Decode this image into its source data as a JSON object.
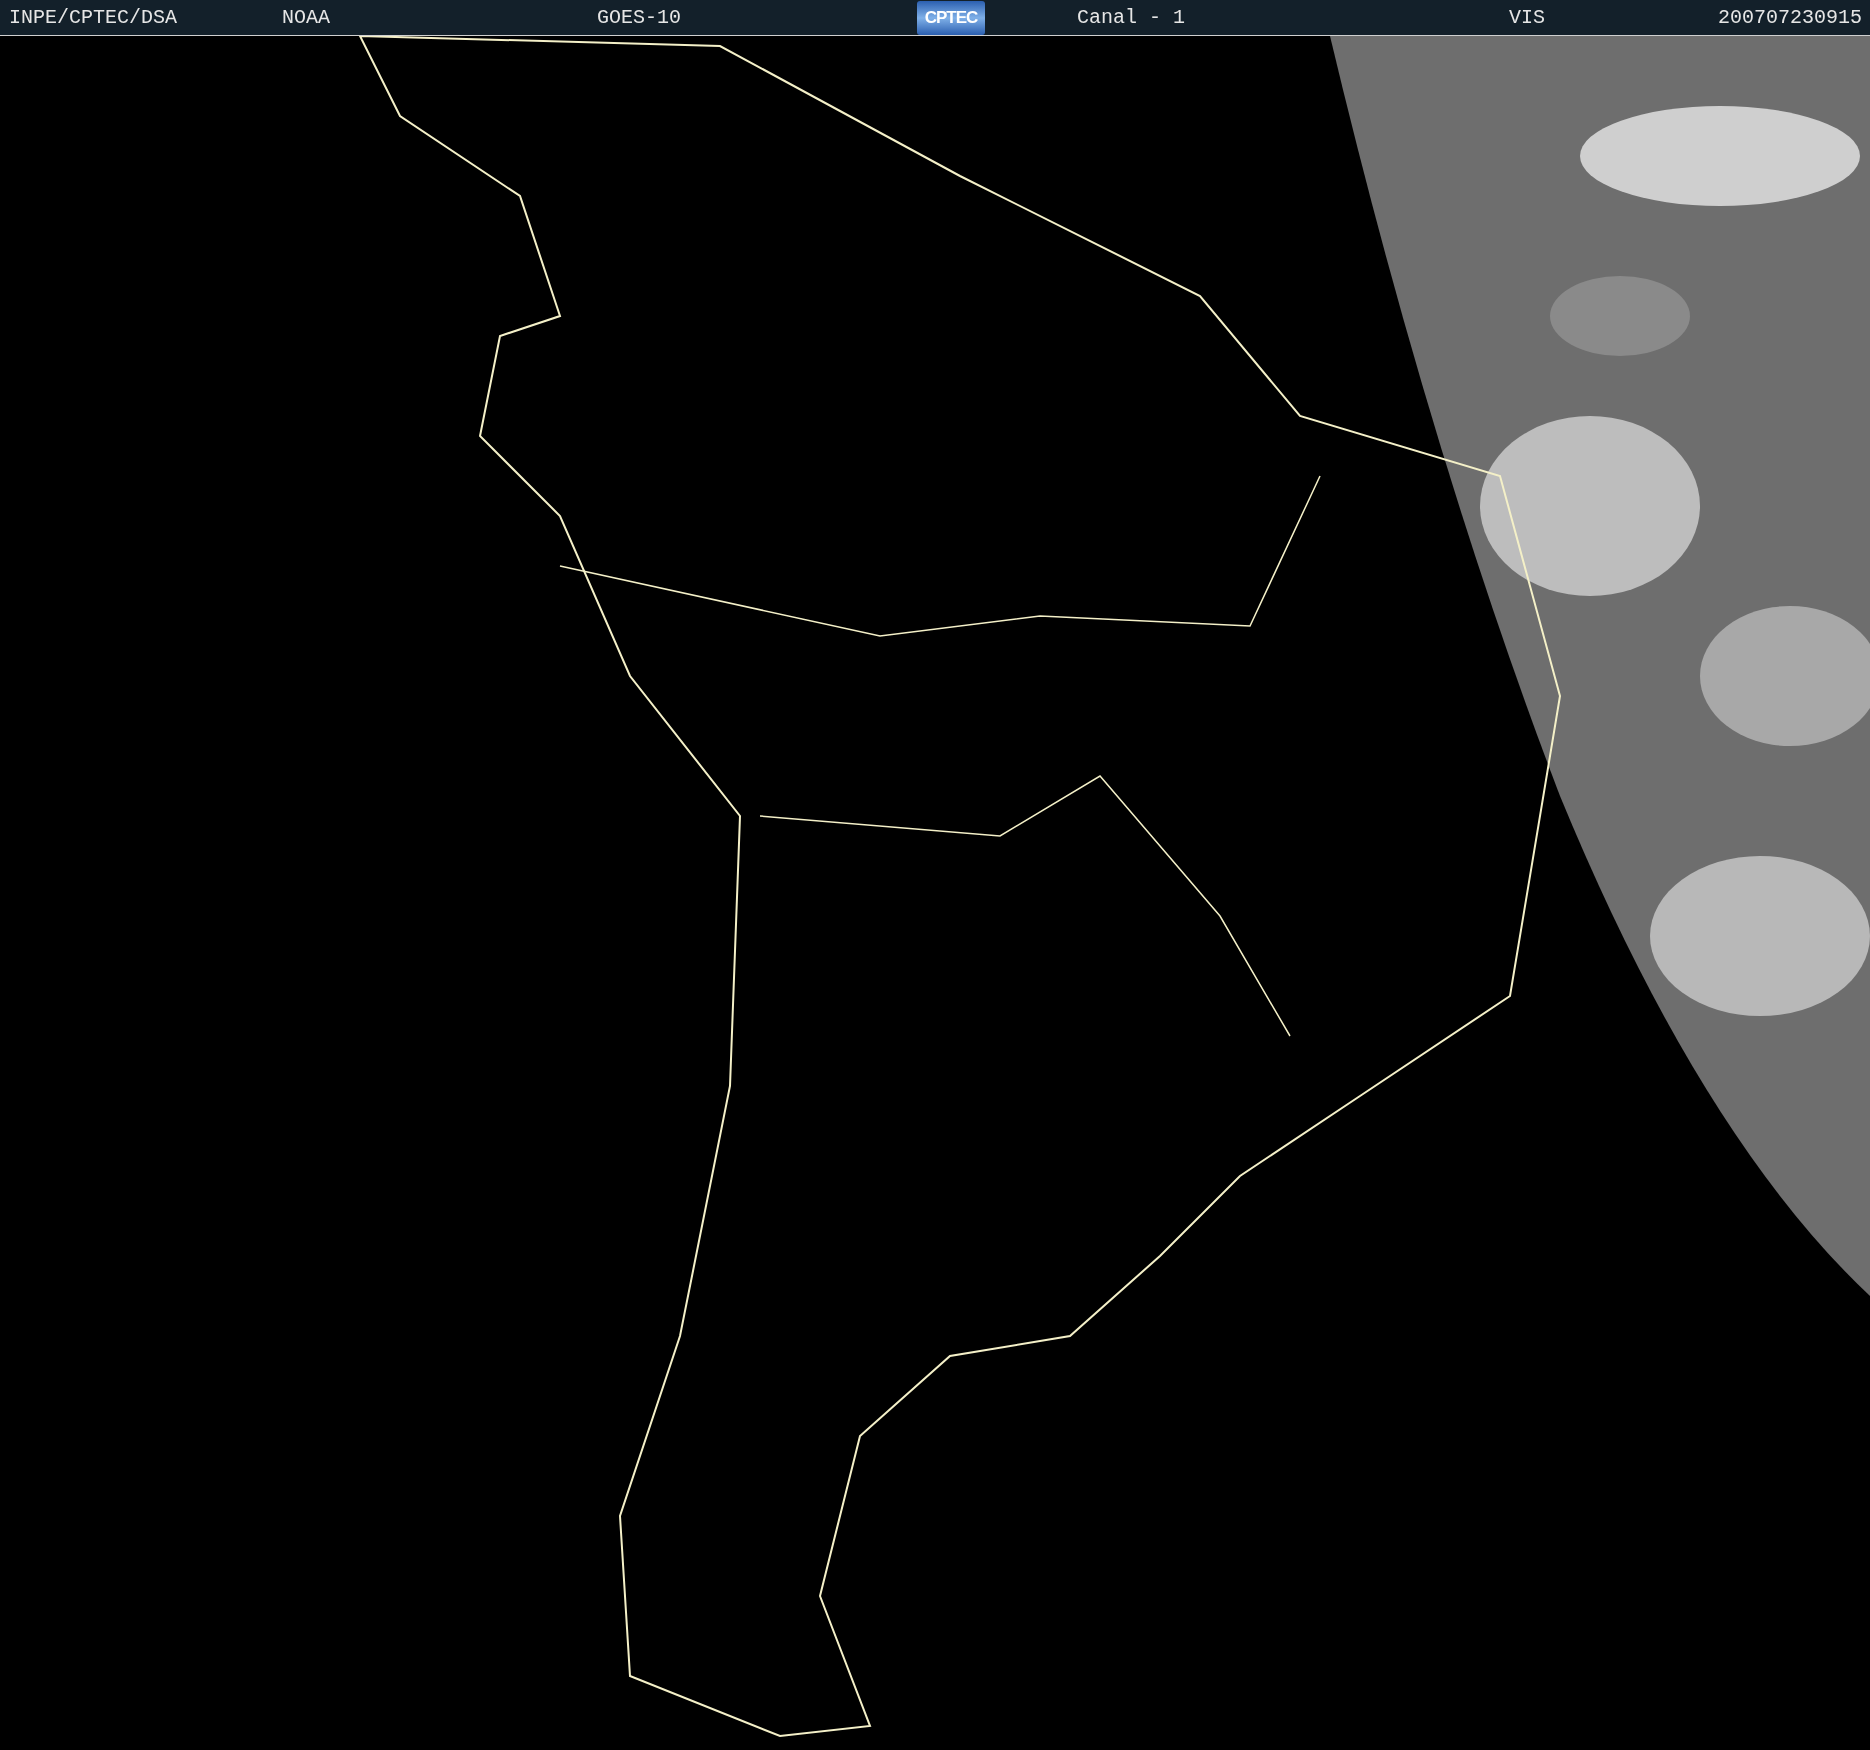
{
  "header": {
    "source": "INPE/CPTEC/DSA",
    "agency": "NOAA",
    "satellite": "GOES-10",
    "logo": "CPTEC",
    "channel": "Canal - 1",
    "band": "VIS",
    "timestamp": "200707230915"
  },
  "image": {
    "kind": "map-picture"
  }
}
